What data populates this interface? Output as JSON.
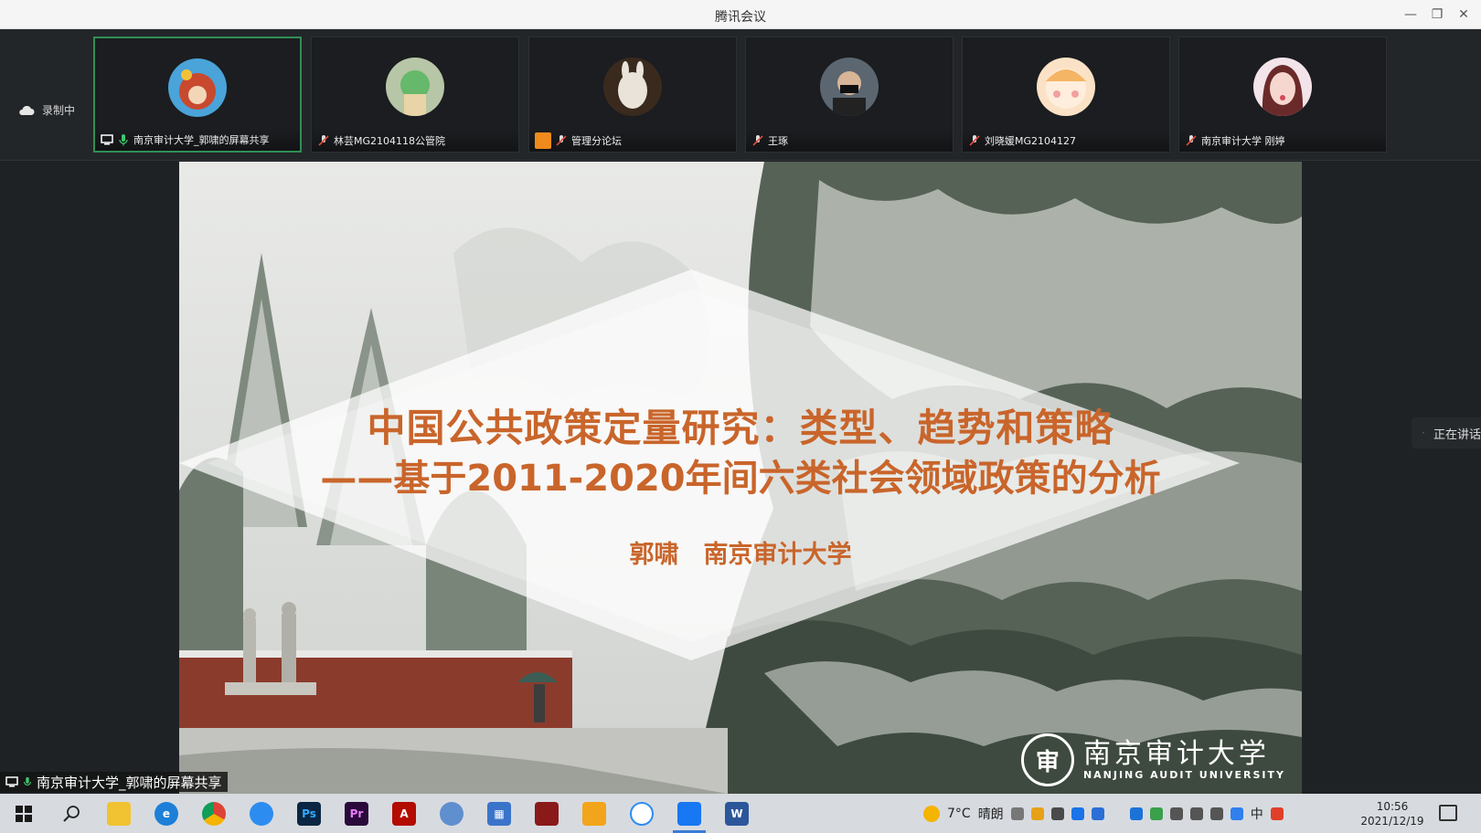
{
  "window": {
    "title": "腾讯会议"
  },
  "recording": {
    "label": "录制中"
  },
  "participants": [
    {
      "name": "南京审计大学_郭啸的屏幕共享",
      "active": true,
      "sharing": true
    },
    {
      "name": "林芸MG2104118公管院",
      "active": false
    },
    {
      "name": "管理分论坛",
      "active": false,
      "host": true
    },
    {
      "name": "王琢",
      "active": false
    },
    {
      "name": "刘晓媛MG2104127",
      "active": false
    },
    {
      "name": "南京审计大学 刚婷",
      "active": false
    }
  ],
  "slide": {
    "title_line1": "中国公共政策定量研究：类型、趋势和策略",
    "title_line2": "——基于2011-2020年间六类社会领域政策的分析",
    "author": "郭啸　南京审计大学",
    "university_cn": "南京审计大学",
    "university_en": "NANJING AUDIT UNIVERSITY",
    "seal_char": "审"
  },
  "share_label": "南京审计大学_郭啸的屏幕共享",
  "speaking_label": "正在讲话",
  "taskbar": {
    "weather_temp": "7°C",
    "weather_text": "晴朗",
    "ime": "中",
    "time": "10:56",
    "date": "2021/12/19",
    "apps": [
      "start",
      "search",
      "file-explorer",
      "ie",
      "chrome",
      "qq-browser",
      "photoshop",
      "premiere",
      "acrobat",
      "browser-globe",
      "apps-grid",
      "red-app",
      "shield-app",
      "baidu-netdisk",
      "tencent-meeting",
      "word"
    ]
  },
  "colors": {
    "accent": "#2f8f55",
    "slide_text": "#c9652b",
    "taskbar": "#d7dbe0"
  }
}
